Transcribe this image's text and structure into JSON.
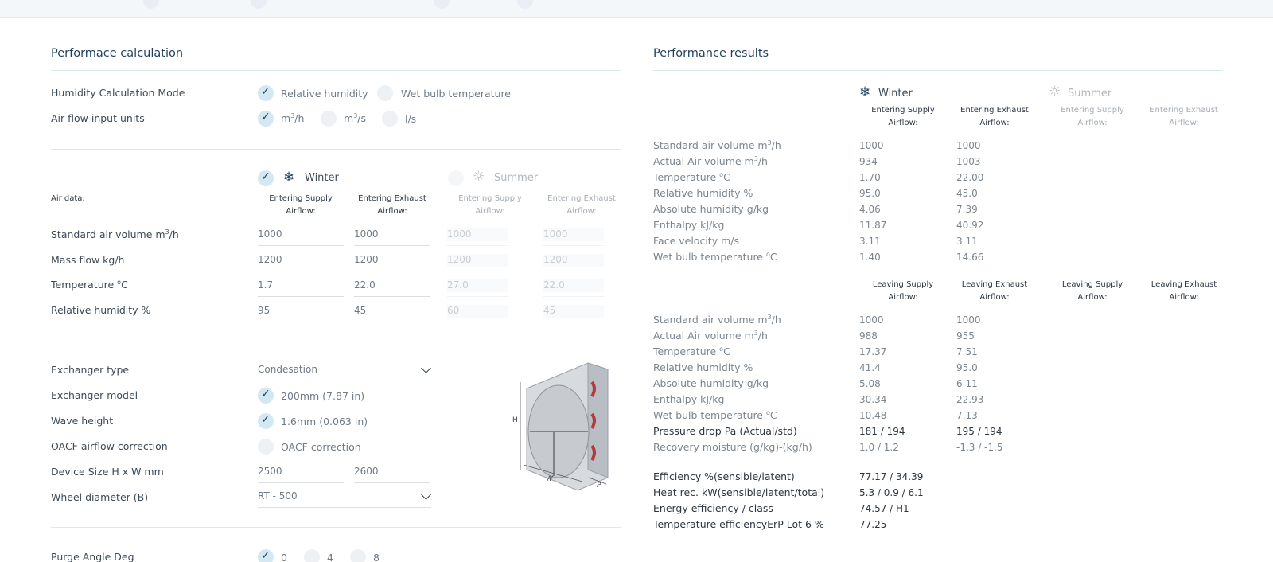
{
  "left": {
    "title": "Performace calculation",
    "humidity_mode": {
      "label": "Humidity Calculation Mode",
      "options": [
        "Relative humidity",
        "Wet bulb temperature"
      ],
      "selected": 0
    },
    "airflow_units": {
      "label": "Air flow input units",
      "options": [
        "m3/h",
        "m3/s",
        "l/s"
      ],
      "selected": 0
    },
    "season": {
      "winter": "Winter",
      "summer": "Summer",
      "selected": "Winter"
    },
    "air_data_label": "Air data:",
    "columns": [
      "Entering Supply Airflow:",
      "Entering Exhaust Airflow:",
      "Entering Supply Airflow:",
      "Entering Exhaust Airflow:"
    ],
    "rows": [
      {
        "label": "Standard air volume m3/h",
        "values": [
          "1000",
          "1000",
          "1000",
          "1000"
        ]
      },
      {
        "label": "Mass flow kg/h",
        "values": [
          "1200",
          "1200",
          "1200",
          "1200"
        ]
      },
      {
        "label": "Temperature oC",
        "values": [
          "1.7",
          "22.0",
          "27.0",
          "22.0"
        ]
      },
      {
        "label": "Relative humidity %",
        "values": [
          "95",
          "45",
          "60",
          "45"
        ]
      }
    ],
    "exchanger_type": {
      "label": "Exchanger type",
      "value": "Condesation"
    },
    "exchanger_model": {
      "label": "Exchanger model",
      "option": "200mm (7.87 in)",
      "checked": true
    },
    "wave_height": {
      "label": "Wave height",
      "option": "1.6mm (0.063 in)",
      "checked": true
    },
    "oacf": {
      "label": "OACF airflow correction",
      "option": "OACF correction",
      "checked": false
    },
    "device_size": {
      "label": "Device Size H x W mm",
      "h": "2500",
      "w": "2600"
    },
    "wheel_diameter": {
      "label": "Wheel diameter (B)",
      "value": "RT - 500"
    },
    "purge_angle": {
      "label": "Purge Angle Deg",
      "options": [
        "0",
        "4",
        "8"
      ],
      "selected": 0
    },
    "diagram": {
      "h": "H",
      "w": "W",
      "p": "P"
    }
  },
  "right": {
    "title": "Performance results",
    "winter": "Winter",
    "summer": "Summer",
    "entering_cols": [
      "Entering Supply Airflow:",
      "Entering Exhaust Airflow:",
      "Entering Supply Airflow:",
      "Entering Exhaust Airflow:"
    ],
    "entering_rows": [
      {
        "label": "Standard air volume m3/h",
        "values": [
          "1000",
          "1000"
        ]
      },
      {
        "label": "Actual Air volume m3/h",
        "values": [
          "934",
          "1003"
        ]
      },
      {
        "label": "Temperature oC",
        "values": [
          "1.70",
          "22.00"
        ]
      },
      {
        "label": "Relative humidity %",
        "values": [
          "95.0",
          "45.0"
        ]
      },
      {
        "label": "Absolute humidity g/kg",
        "values": [
          "4.06",
          "7.39"
        ]
      },
      {
        "label": "Enthalpy kJ/kg",
        "values": [
          "11.87",
          "40.92"
        ]
      },
      {
        "label": "Face velocity m/s",
        "values": [
          "3.11",
          "3.11"
        ]
      },
      {
        "label": "Wet bulb temperature oC",
        "values": [
          "1.40",
          "14.66"
        ]
      }
    ],
    "leaving_cols": [
      "Leaving Supply Airflow:",
      "Leaving Exhaust Airflow:",
      "Leaving Supply Airflow:",
      "Leaving Exhaust Airflow:"
    ],
    "leaving_rows": [
      {
        "label": "Standard air volume m3/h",
        "values": [
          "1000",
          "1000"
        ]
      },
      {
        "label": "Actual Air volume m3/h",
        "values": [
          "988",
          "955"
        ]
      },
      {
        "label": "Temperature oC",
        "values": [
          "17.37",
          "7.51"
        ]
      },
      {
        "label": "Relative humidity %",
        "values": [
          "41.4",
          "95.0"
        ]
      },
      {
        "label": "Absolute humidity g/kg",
        "values": [
          "5.08",
          "6.11"
        ]
      },
      {
        "label": "Enthalpy kJ/kg",
        "values": [
          "30.34",
          "22.93"
        ]
      },
      {
        "label": "Wet bulb temperature oC",
        "values": [
          "10.48",
          "7.13"
        ]
      },
      {
        "label": "Pressure drop Pa (Actual/std)",
        "values": [
          "181 / 194",
          "195 / 194"
        ]
      },
      {
        "label": "Recovery moisture (g/kg)-(kg/h)",
        "values": [
          "1.0 / 1.2",
          "-1.3 / -1.5"
        ]
      }
    ],
    "summary": [
      {
        "label": "Efficiency %(sensible/latent)",
        "value": "77.17 / 34.39"
      },
      {
        "label": "Heat rec. kW(sensible/latent/total)",
        "value": "5.3 / 0.9 / 6.1"
      },
      {
        "label": "Energy efficiency / class",
        "value": "74.57 / H1"
      },
      {
        "label": "Temperature efficiencyErP Lot 6 %",
        "value": "77.25"
      }
    ]
  },
  "colors": {
    "accent": "#1f3f5c",
    "radio_on": "#d4e8f4",
    "rule": "#d6ebe9"
  },
  "icons": {
    "winter": "snowflake-icon",
    "summer": "sun-icon",
    "dropdown": "chevron-down-icon",
    "check": "check-icon"
  }
}
